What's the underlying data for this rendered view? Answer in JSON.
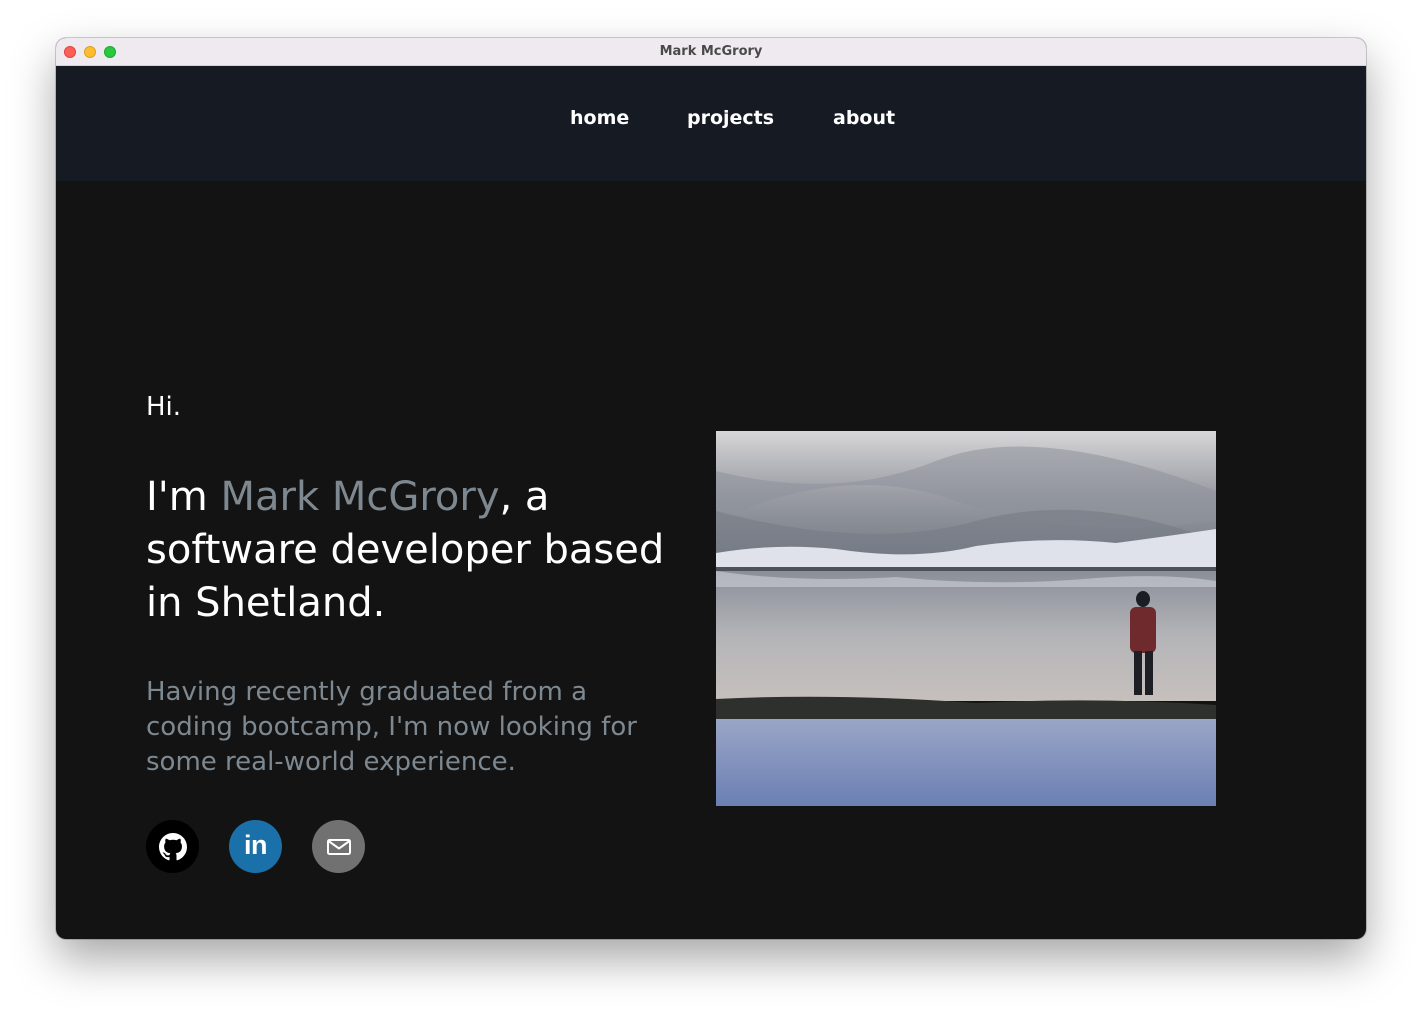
{
  "window": {
    "title": "Mark McGrory"
  },
  "nav": {
    "items": [
      {
        "label": "home"
      },
      {
        "label": "projects"
      },
      {
        "label": "about"
      }
    ]
  },
  "hero": {
    "greeting": "Hi.",
    "headline_prefix": "I'm ",
    "name": "Mark McGrory",
    "headline_suffix": ", a software developer based in Shetland.",
    "bio": "Having recently graduated from a coding bootcamp, I'm now looking for some real-world experience."
  },
  "social": [
    {
      "icon": "github-icon",
      "color": "#000000"
    },
    {
      "icon": "linkedin-icon",
      "color": "#1a71a9",
      "text": "in"
    },
    {
      "icon": "mail-icon",
      "color": "#717171"
    }
  ],
  "photo": {
    "description_icon": "landscape-photo"
  },
  "colors": {
    "page_bg": "#131313",
    "nav_bg": "#161b23",
    "accent_name": "#7d8891",
    "bio_text": "#7d8891"
  }
}
